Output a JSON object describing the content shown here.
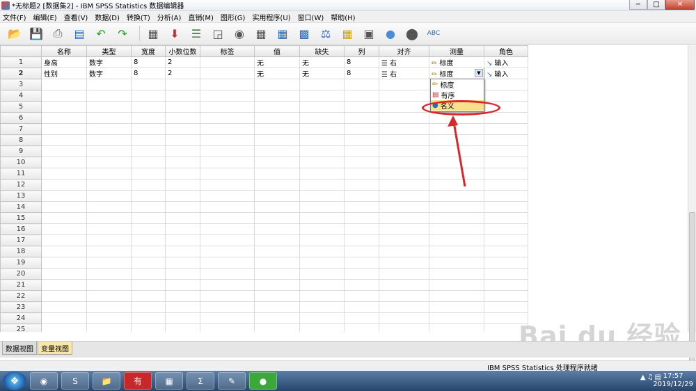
{
  "window": {
    "title": "*无标题2 [数据集2] - IBM SPSS Statistics 数据编辑器",
    "min": "−",
    "max": "□",
    "close": "✕"
  },
  "menu": [
    "文件(F)",
    "编辑(E)",
    "查看(V)",
    "数据(D)",
    "转换(T)",
    "分析(A)",
    "直销(M)",
    "图形(G)",
    "实用程序(U)",
    "窗口(W)",
    "帮助(H)"
  ],
  "columns": [
    "名称",
    "类型",
    "宽度",
    "小数位数",
    "标签",
    "值",
    "缺失",
    "列",
    "对齐",
    "测量",
    "角色"
  ],
  "rows": [
    {
      "num": "1",
      "name": "身高",
      "type": "数字",
      "width": "8",
      "decimals": "2",
      "label": "",
      "values": "无",
      "missing": "无",
      "columns": "8",
      "align": "右",
      "measure": "标度",
      "role": "输入"
    },
    {
      "num": "2",
      "name": "性别",
      "type": "数字",
      "width": "8",
      "decimals": "2",
      "label": "",
      "values": "无",
      "missing": "无",
      "columns": "8",
      "align": "右",
      "measure": "标度",
      "role": "输入"
    }
  ],
  "empty_row_numbers": [
    "3",
    "4",
    "5",
    "6",
    "7",
    "8",
    "9",
    "10",
    "11",
    "12",
    "13",
    "14",
    "15",
    "16",
    "17",
    "18",
    "19",
    "20",
    "21",
    "22",
    "23",
    "24",
    "25"
  ],
  "measure_dropdown": {
    "options": [
      "标度",
      "有序",
      "名义"
    ],
    "highlighted": "名义"
  },
  "view_tabs": {
    "data_view": "数据视图",
    "variable_view": "变量视图"
  },
  "status": "IBM SPSS Statistics 处理程序就绪",
  "clock": {
    "time": "17:57",
    "date": "2019/12/29"
  },
  "colors": {
    "highlight": "#f6e08c",
    "annotation_red": "#d9262c",
    "tab_selected": "#f8e7a8"
  },
  "watermark": "Bai du 经验"
}
